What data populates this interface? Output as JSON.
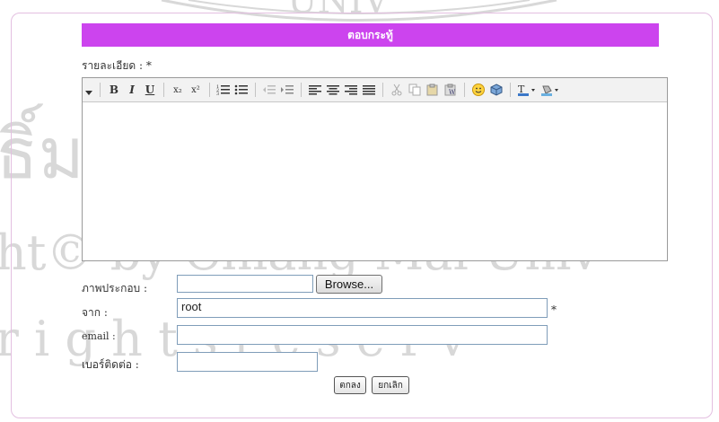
{
  "form": {
    "title": "ตอบกระทู้",
    "detail_label": "รายละเอียด : *",
    "image_label": "ภาพประกอบ :",
    "browse_label": "Browse...",
    "from_label": "จาก :",
    "from_value": "root",
    "required_mark": "*",
    "email_label": "email :",
    "email_value": "",
    "phone_label": "เบอร์ติดต่อ :",
    "phone_value": "",
    "ok_label": "ตกลง",
    "cancel_label": "ยกเลิก"
  },
  "toolbar": {
    "bold": "B",
    "italic": "I",
    "underline": "U",
    "subscript": "x₂",
    "superscript": "x²",
    "icons": [
      "collapse-icon",
      "bold-icon",
      "italic-icon",
      "underline-icon",
      "subscript-icon",
      "superscript-icon",
      "ordered-list-icon",
      "unordered-list-icon",
      "outdent-icon",
      "indent-icon",
      "align-left-icon",
      "align-center-icon",
      "align-right-icon",
      "justify-icon",
      "cut-icon",
      "copy-icon",
      "paste-icon",
      "paste-word-icon",
      "smiley-icon",
      "special-char-icon",
      "text-color-icon",
      "background-color-icon"
    ]
  },
  "watermark": {
    "line1": "ธิ์มหาวิทยาลัยเชียงใ",
    "line2": "ht© by Chiang Mai Univ",
    "line3": "r i g h t s   r e s e r v",
    "top": "UNIV"
  },
  "colors": {
    "header_bg": "#cc44ee",
    "panel_border": "#e3bfe0",
    "watermark": "#d8d8d8"
  }
}
